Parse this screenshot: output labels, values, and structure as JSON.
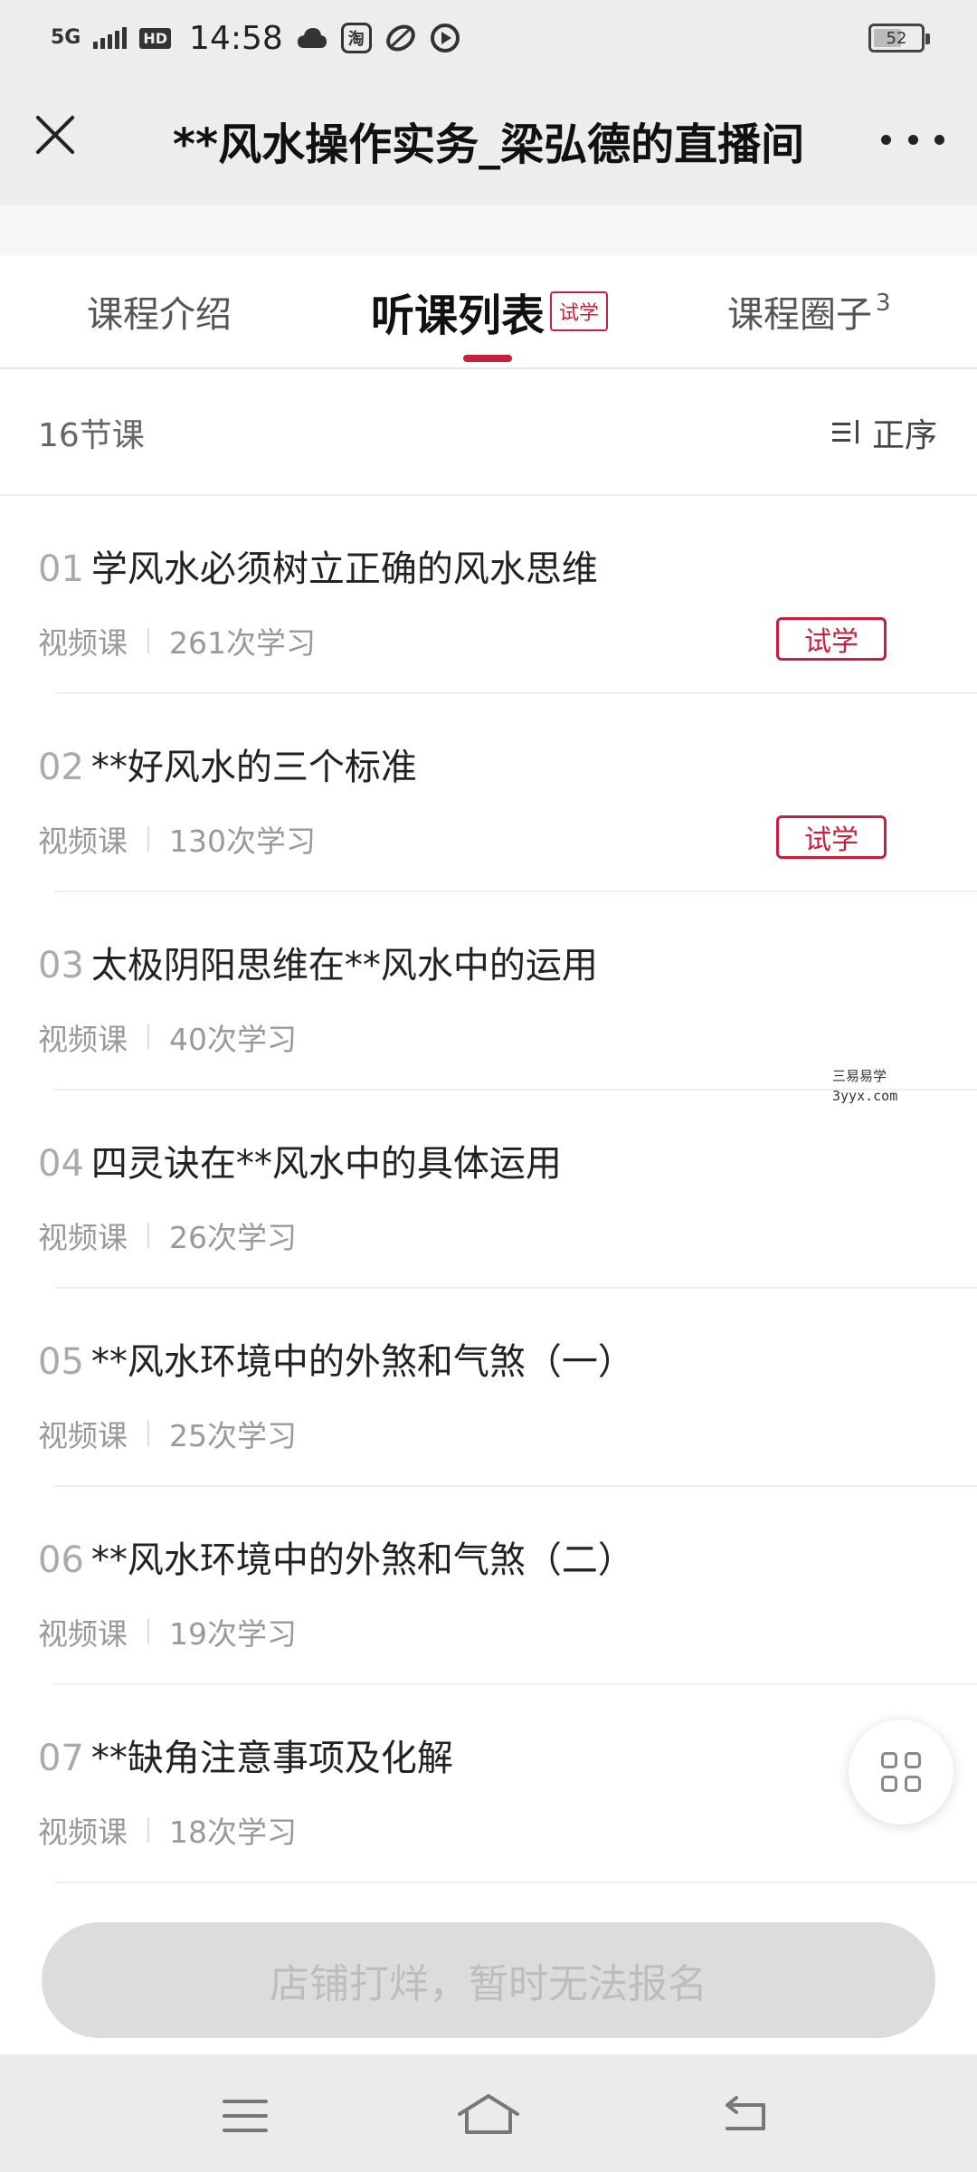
{
  "status_bar": {
    "network": "5G",
    "hd": "HD",
    "time": "14:58",
    "app_icons": [
      "cloud-icon",
      "taobao-icon",
      "leaf-icon",
      "play-icon"
    ],
    "taobao_glyph": "淘",
    "battery": "52"
  },
  "header": {
    "title": "**风水操作实务_梁弘德的直播间"
  },
  "tabs": {
    "intro": "课程介绍",
    "list": "听课列表",
    "list_badge": "试学",
    "circle": "课程圈子",
    "circle_count": "3"
  },
  "list_header": {
    "lesson_count": "16节课",
    "sort_label": "正序"
  },
  "lessons": [
    {
      "num": "01",
      "title": "学风水必须树立正确的风水思维",
      "type": "视频课",
      "views": "261次学习",
      "badge": "试学"
    },
    {
      "num": "02",
      "title": "**好风水的三个标准",
      "type": "视频课",
      "views": "130次学习",
      "badge": "试学"
    },
    {
      "num": "03",
      "title": "太极阴阳思维在**风水中的运用",
      "type": "视频课",
      "views": "40次学习",
      "badge": ""
    },
    {
      "num": "04",
      "title": "四灵诀在**风水中的具体运用",
      "type": "视频课",
      "views": "26次学习",
      "badge": ""
    },
    {
      "num": "05",
      "title": "**风水环境中的外煞和气煞（一）",
      "type": "视频课",
      "views": "25次学习",
      "badge": ""
    },
    {
      "num": "06",
      "title": "**风水环境中的外煞和气煞（二）",
      "type": "视频课",
      "views": "19次学习",
      "badge": ""
    },
    {
      "num": "07",
      "title": "**缺角注意事项及化解",
      "type": "视频课",
      "views": "18次学习",
      "badge": ""
    }
  ],
  "watermark": {
    "line1": "三易易学",
    "line2": "3yyx.com"
  },
  "footer": {
    "signup_label": "店铺打烊，暂时无法报名"
  },
  "colors": {
    "accent": "#c5213c",
    "header_bg": "#ededed",
    "disabled_button": "#dcdcdc"
  }
}
